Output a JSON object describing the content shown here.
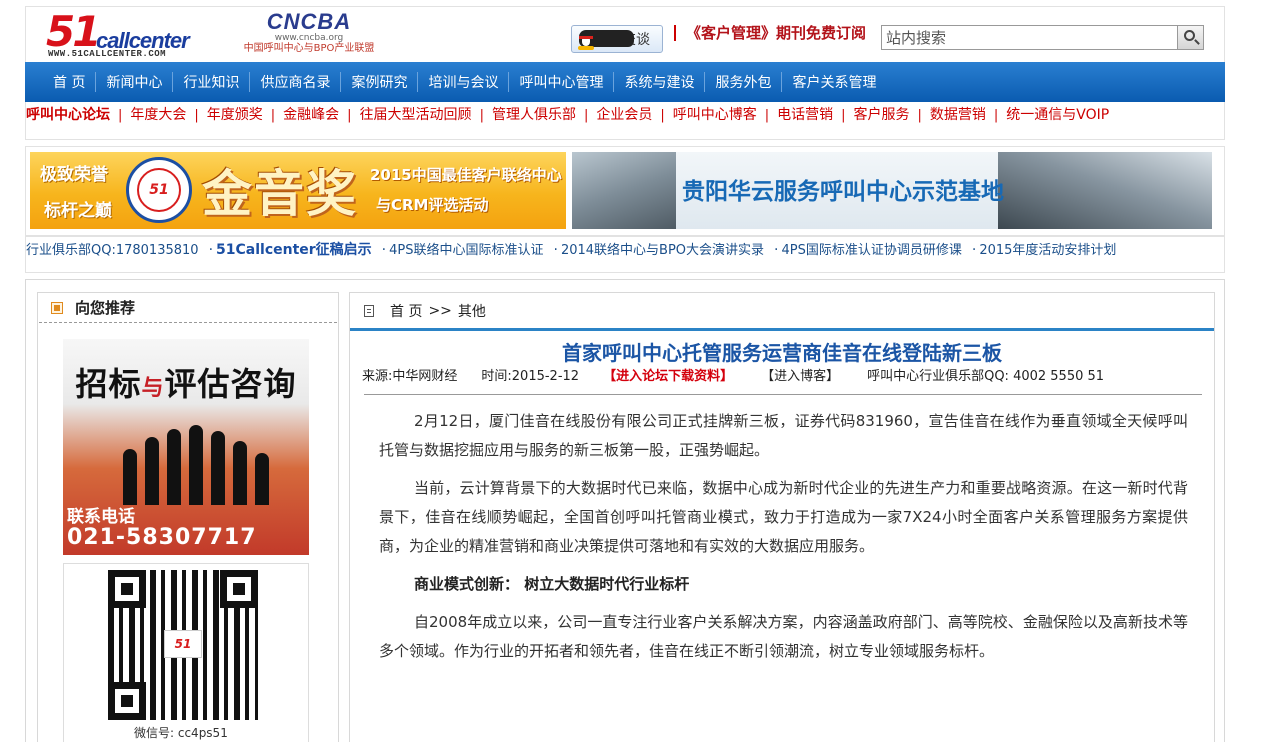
{
  "header": {
    "logo_51": "51",
    "logo_call": "callcenter",
    "logo_url": "WWW.51CALLCENTER.COM",
    "cncba_title": "CNCBA",
    "cncba_url": "www.cncba.org",
    "cncba_sub": "中国呼叫中心与BPO产业联盟",
    "qq_label": "QQ交谈",
    "promo_text": "《客户管理》期刊免费订阅",
    "search_placeholder": "站内搜索"
  },
  "nav": {
    "items": [
      "首 页",
      "新闻中心",
      "行业知识",
      "供应商名录",
      "案例研究",
      "培训与会议",
      "呼叫中心管理",
      "系统与建设",
      "服务外包",
      "客户关系管理"
    ]
  },
  "subnav": {
    "items": [
      "呼叫中心论坛",
      "年度大会",
      "年度颁奖",
      "金融峰会",
      "往届大型活动回顾",
      "管理人俱乐部",
      "企业会员",
      "呼叫中心博客",
      "电话营销",
      "客户服务",
      "数据营销",
      "统一通信与VOIP"
    ]
  },
  "banners": {
    "gold": {
      "tag1": "极致荣誉",
      "tag2": "标杆之巅",
      "medal": "51",
      "main": "金音奖",
      "line1": "2015中国最佳客户联络中心",
      "line2": "与CRM评选活动"
    },
    "blue": {
      "text": "贵阳华云服务呼叫中心示范基地"
    }
  },
  "ticker": {
    "club": "行业俱乐部QQ:1780135810",
    "items": [
      "51Callcenter征稿启示",
      "4PS联络中心国际标准认证",
      "2014联络中心与BPO大会演讲实录",
      "4PS国际标准认证协调员研修课",
      "2015年度活动安排计划"
    ]
  },
  "left": {
    "title": "向您推荐",
    "ad_head_1": "招标",
    "ad_head_mid": "与",
    "ad_head_2": "评估咨询",
    "ad_tel_label": "联系电话",
    "ad_tel": "021-58307717",
    "qr_center": "51",
    "qr_caption": "微信号: cc4ps51"
  },
  "article": {
    "breadcrumb_home": "首 页",
    "breadcrumb_sep": ">>",
    "breadcrumb_current": "其他",
    "title": "首家呼叫中心托管服务运营商佳音在线登陆新三板",
    "source": "来源:中华网财经",
    "time": "时间:2015-2-12",
    "forum_link": "【进入论坛下载资料】",
    "blog_link": "【进入博客】",
    "club_qq": "呼叫中心行业俱乐部QQ: 4002 5550 51",
    "paragraphs": [
      "2月12日，厦门佳音在线股份有限公司正式挂牌新三板，证券代码831960，宣告佳音在线作为垂直领域全天候呼叫托管与数据挖掘应用与服务的新三板第一股，正强势崛起。",
      "当前，云计算背景下的大数据时代已来临，数据中心成为新时代企业的先进生产力和重要战略资源。在这一新时代背景下，佳音在线顺势崛起，全国首创呼叫托管商业模式，致力于打造成为一家7X24小时全面客户关系管理服务方案提供商，为企业的精准营销和商业决策提供可落地和有实效的大数据应用服务。"
    ],
    "subheading": "商业模式创新：  树立大数据时代行业标杆",
    "paragraph3": "自2008年成立以来，公司一直专注行业客户关系解决方案，内容涵盖政府部门、高等院校、金融保险以及高新技术等多个领域。作为行业的开拓者和领先者，佳音在线正不断引领潮流，树立专业领域服务标杆。"
  },
  "colors": {
    "nav_blue": "#0a5bb0",
    "accent_red": "#c00000",
    "title_blue": "#1b55a5"
  }
}
